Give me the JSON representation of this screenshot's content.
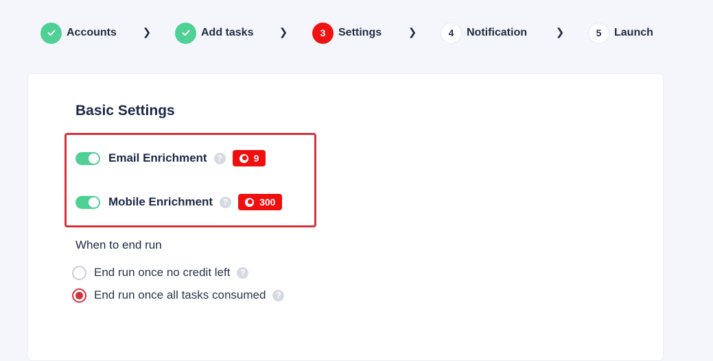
{
  "stepper": {
    "steps": [
      {
        "number": "",
        "label": "Accounts",
        "state": "done"
      },
      {
        "number": "",
        "label": "Add tasks",
        "state": "done"
      },
      {
        "number": "3",
        "label": "Settings",
        "state": "active"
      },
      {
        "number": "4",
        "label": "Notification",
        "state": "pending"
      },
      {
        "number": "5",
        "label": "Launch",
        "state": "pending"
      }
    ],
    "separator_icon": "chevron-right-icon"
  },
  "settings": {
    "title": "Basic Settings",
    "enrichments": [
      {
        "label": "Email Enrichment",
        "enabled": true,
        "credits": "9",
        "help": "?"
      },
      {
        "label": "Mobile Enrichment",
        "enabled": true,
        "credits": "300",
        "help": "?"
      }
    ],
    "end_run": {
      "label": "When to end run",
      "options": [
        {
          "label": "End run once no credit left",
          "selected": false,
          "help": "?"
        },
        {
          "label": "End run once all tasks consumed",
          "selected": true,
          "help": "?"
        }
      ]
    }
  },
  "colors": {
    "done": "#4fd196",
    "active": "#ef1313",
    "highlight": "#d6303c",
    "toggle_on": "#4fd196"
  }
}
